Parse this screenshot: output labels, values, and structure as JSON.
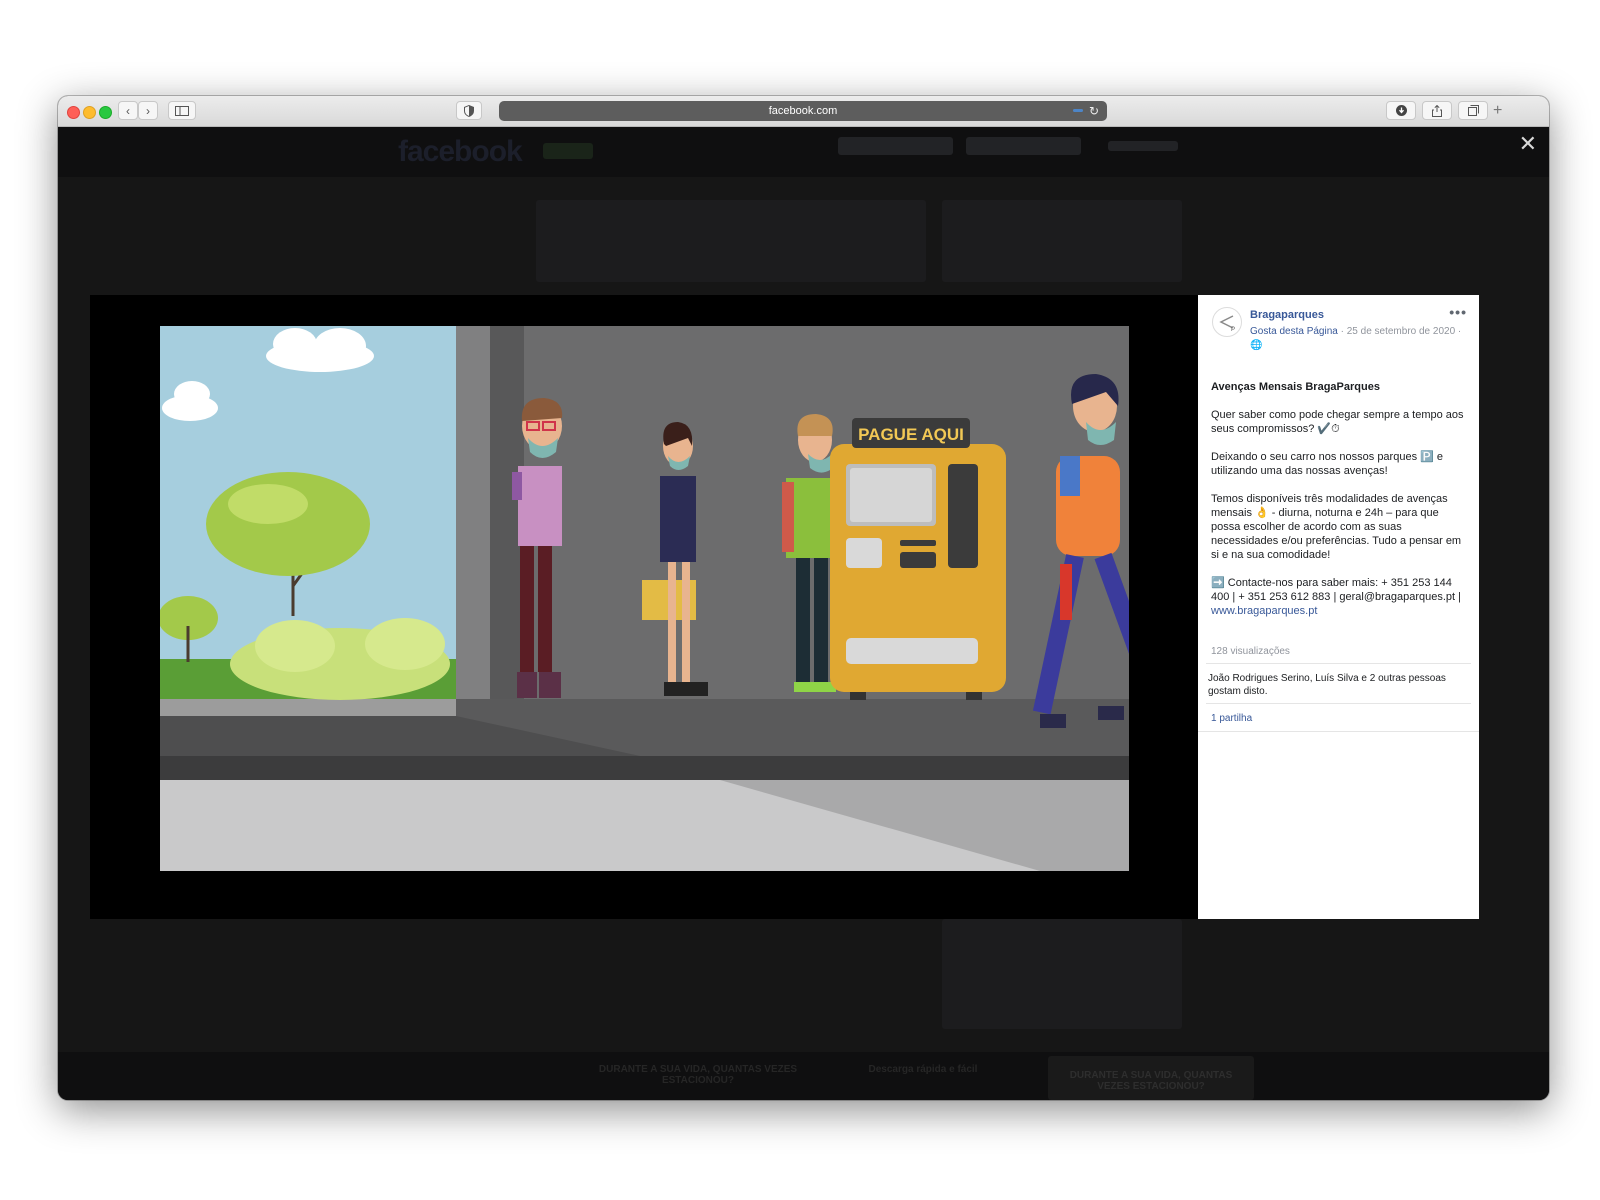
{
  "browser": {
    "url": "facebook.com"
  },
  "facebook": {
    "logo": "facebook"
  },
  "video": {
    "sign": "PAGUE AQUI"
  },
  "post": {
    "page_name": "Bragaparques",
    "like_page": "Gosta desta Página",
    "date": " · 25 de setembro de 2020 ·",
    "title": "Avenças Mensais BragaParques",
    "para1": "Quer saber como pode chegar sempre a tempo aos seus compromissos? ✔️⏱",
    "para2": "Deixando o seu carro nos nossos parques 🅿️ e utilizando uma das nossas avenças!",
    "para3": "Temos disponíveis três modalidades de avenças mensais 👌 - diurna, noturna e 24h – para que possa escolher de acordo com as suas necessidades e/ou preferências. Tudo a pensar em si e na sua comodidade!",
    "para4_text": "➡️ Contacte-nos para saber mais: + 351 253 144 400 | + 351 253 612 883 | geral@bragaparques.pt | ",
    "para4_link": "www.bragaparques.pt",
    "views": "128 visualizações",
    "likes": "João Rodrigues Serino, Luís Silva e 2 outras pessoas gostam disto.",
    "shares": "1 partilha"
  },
  "background_page": {
    "banner_left": "DURANTE A SUA VIDA, QUANTAS VEZES ESTACIONOU?",
    "banner_mid": "Descarga rápida e fácil",
    "banner_right": "DURANTE A SUA VIDA, QUANTAS VEZES ESTACIONOU?"
  }
}
